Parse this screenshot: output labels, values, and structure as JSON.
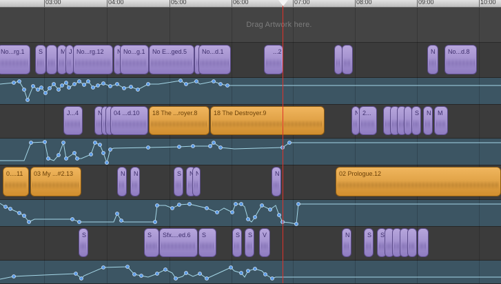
{
  "ruler": {
    "labels": [
      "03:00",
      "04:00",
      "05:00",
      "06:00",
      "07:00",
      "08:00",
      "09:00",
      "10:00"
    ]
  },
  "artwork": {
    "hint": "Drag Artwork here."
  },
  "colors": {
    "purple_region": "#a895d0",
    "orange_region": "#e6a445",
    "automation_lane": "#3c5563",
    "automation_line": "#a6d8e8",
    "automation_point": "#5b9be6",
    "playhead": "#e0322a"
  },
  "regions": [
    {
      "label": "No...rg.1",
      "color": "purple"
    },
    {
      "label": "S",
      "color": "purple"
    },
    {
      "label": "",
      "color": "purple"
    },
    {
      "label": "M",
      "color": "purple"
    },
    {
      "label": "J",
      "color": "purple"
    },
    {
      "label": "No...rg.12",
      "color": "purple"
    },
    {
      "label": "N",
      "color": "purple"
    },
    {
      "label": "No...g.1",
      "color": "purple"
    },
    {
      "label": "No E...ged.5",
      "color": "purple"
    },
    {
      "label": "",
      "color": "purple"
    },
    {
      "label": "No...d.1",
      "color": "purple"
    },
    {
      "label": "...2",
      "color": "purple"
    },
    {
      "label": "",
      "color": "purple"
    },
    {
      "label": "",
      "color": "purple"
    },
    {
      "label": "N",
      "color": "purple"
    },
    {
      "label": "No...d.8",
      "color": "purple"
    },
    {
      "label": "J...4",
      "color": "purple"
    },
    {
      "label": "N",
      "color": "purple"
    },
    {
      "label": "",
      "color": "purple"
    },
    {
      "label": "",
      "color": "purple"
    },
    {
      "label": "04 ...d.10",
      "color": "purple"
    },
    {
      "label": "18 The ...royer.8",
      "color": "orange"
    },
    {
      "label": "18 The Destroyer.9",
      "color": "orange"
    },
    {
      "label": "N",
      "color": "purple"
    },
    {
      "label": "2...",
      "color": "purple"
    },
    {
      "label": "",
      "color": "purple"
    },
    {
      "label": "",
      "color": "purple"
    },
    {
      "label": "",
      "color": "purple"
    },
    {
      "label": "",
      "color": "purple"
    },
    {
      "label": "S",
      "color": "purple"
    },
    {
      "label": "N",
      "color": "purple"
    },
    {
      "label": "M",
      "color": "purple"
    },
    {
      "label": "0....11",
      "color": "orange"
    },
    {
      "label": "03 My ...#2.13",
      "color": "orange"
    },
    {
      "label": "N",
      "color": "purple"
    },
    {
      "label": "N",
      "color": "purple"
    },
    {
      "label": "S",
      "color": "purple"
    },
    {
      "label": "N",
      "color": "purple"
    },
    {
      "label": "N",
      "color": "purple"
    },
    {
      "label": "N",
      "color": "purple"
    },
    {
      "label": "02 Prologue.12",
      "color": "orange"
    },
    {
      "label": "S",
      "color": "purple"
    },
    {
      "label": "S",
      "color": "purple"
    },
    {
      "label": "Sfx....ed.6",
      "color": "purple"
    },
    {
      "label": "S",
      "color": "purple"
    },
    {
      "label": "S",
      "color": "purple"
    },
    {
      "label": "S",
      "color": "purple"
    },
    {
      "label": "V",
      "color": "purple"
    },
    {
      "label": "N",
      "color": "purple"
    },
    {
      "label": "S",
      "color": "purple"
    },
    {
      "label": "S",
      "color": "purple"
    },
    {
      "label": "",
      "color": "purple"
    },
    {
      "label": "",
      "color": "purple"
    },
    {
      "label": "",
      "color": "purple"
    },
    {
      "label": "",
      "color": "purple"
    },
    {
      "label": "",
      "color": "purple"
    }
  ]
}
